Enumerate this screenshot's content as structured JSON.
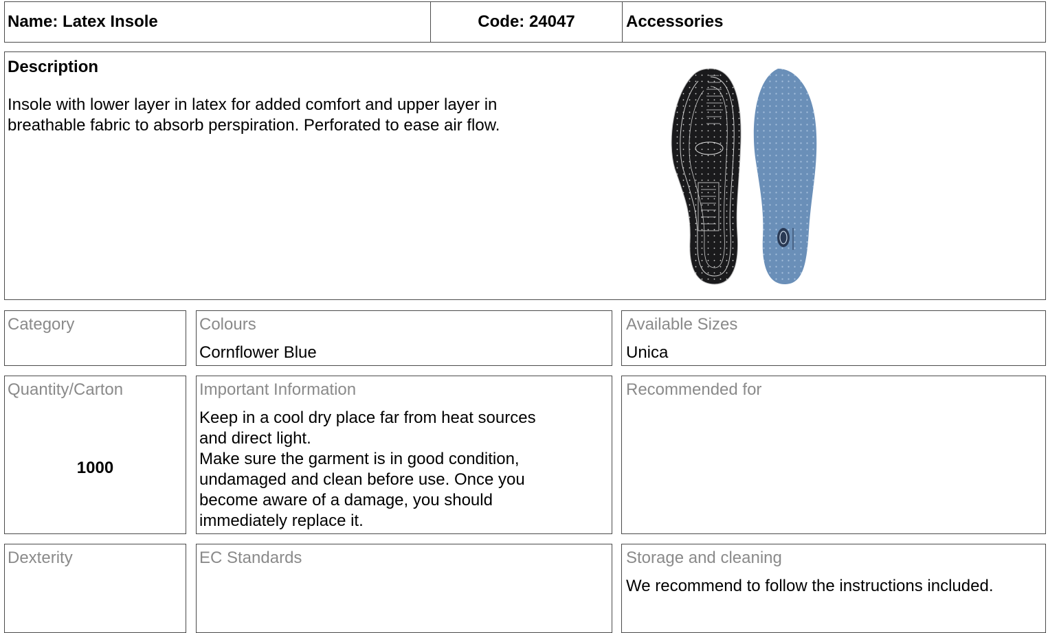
{
  "header": {
    "name": "Name: Latex Insole",
    "code": "Code: 24047",
    "family": "Accessories"
  },
  "description": {
    "title": "Description",
    "text_line1": "Insole with lower layer in latex for added comfort and upper layer in",
    "text_line2": "breathable fabric to absorb perspiration. Perforated to ease air flow.",
    "image_icon": "insole-pair-image"
  },
  "specs": {
    "category": {
      "label": "Category",
      "value": ""
    },
    "colours": {
      "label": "Colours",
      "value": "Cornflower Blue"
    },
    "sizes": {
      "label": "Available Sizes",
      "value": "Unica"
    },
    "quantity": {
      "label": "Quantity/Carton",
      "value": "1000"
    },
    "important": {
      "label": "Important Information",
      "lines": [
        "Keep in a cool dry place far from heat sources",
        "and direct light.",
        "Make sure the garment is in good condition,",
        "undamaged and clean before use. Once you",
        "become aware of a damage, you should",
        "immediately replace it."
      ]
    },
    "recommended": {
      "label": "Recommended for",
      "value": ""
    },
    "dexterity": {
      "label": "Dexterity",
      "value": ""
    },
    "ec_standards": {
      "label": "EC Standards",
      "value": ""
    },
    "storage": {
      "label": "Storage and cleaning",
      "value": "We recommend to follow the instructions included."
    }
  },
  "colors": {
    "border": "#4a4a4a",
    "label_gray": "#8a8a8a",
    "insole_black": "#1a1a1c",
    "insole_blue": "#6a8fb8"
  }
}
